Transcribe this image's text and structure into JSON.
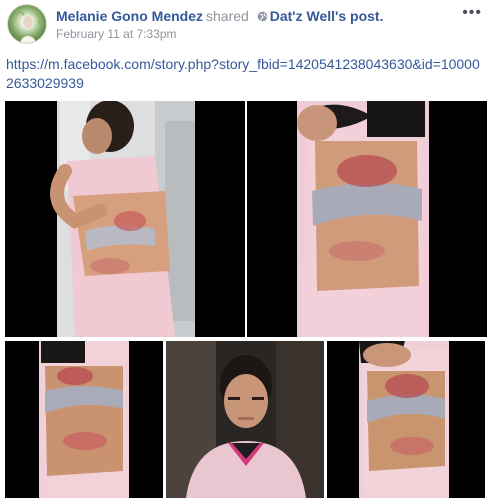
{
  "post": {
    "author": "Melanie Gono Mendez",
    "action": "shared",
    "shared_page": "Dat'z Well's",
    "shared_suffix": "post.",
    "timestamp": "February 11 at 7:33pm",
    "more_label": "•••",
    "link_text": "https://m.facebook.com/story.php?story_fbid=1420541238043630&id=100002633029939"
  },
  "icons": {
    "audience": "globe-icon",
    "menu": "more-options-icon"
  },
  "colors": {
    "link": "#365899",
    "meta": "#90949c",
    "photo_bg": "#000000"
  },
  "photos": [
    {
      "name": "photo-1",
      "description": "back injury"
    },
    {
      "name": "photo-2",
      "description": "back injury close"
    },
    {
      "name": "photo-3",
      "description": "side injury"
    },
    {
      "name": "photo-4",
      "description": "portrait"
    },
    {
      "name": "photo-5",
      "description": "back injury"
    }
  ]
}
